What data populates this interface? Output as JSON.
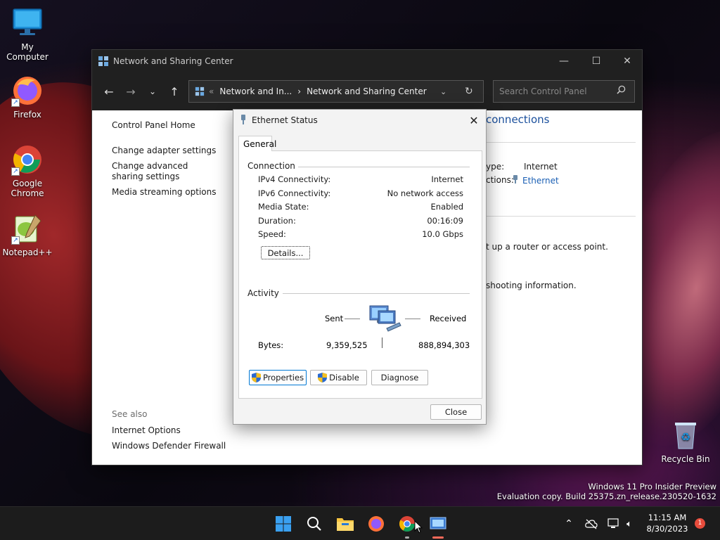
{
  "desktop": {
    "icons": [
      {
        "label": "My Computer"
      },
      {
        "label": "Firefox"
      },
      {
        "label": "Google Chrome"
      },
      {
        "label": "Notepad++"
      },
      {
        "label": "Recycle Bin"
      }
    ],
    "watermark": {
      "line1": "Windows 11 Pro Insider Preview",
      "line2": "Evaluation copy. Build 25375.zn_release.230520-1632"
    }
  },
  "window": {
    "title": "Network and Sharing Center",
    "address": {
      "prefix": "«",
      "crumb1": "Network and In...",
      "sep": "›",
      "crumb2": "Network and Sharing Center"
    },
    "search_placeholder": "Search Control Panel",
    "left_nav": {
      "home": "Control Panel Home",
      "items": [
        "Change adapter settings",
        "Change advanced sharing settings",
        "Media streaming options"
      ]
    },
    "see_also": {
      "header": "See also",
      "items": [
        "Internet Options",
        "Windows Defender Firewall"
      ]
    },
    "main": {
      "heading_fragment": "connections",
      "type_label": "ype:",
      "type_value": "Internet",
      "connections_label": "ctions:",
      "connections_value": "Ethernet",
      "router_text": "t up a router or access point.",
      "troubleshoot_text": "shooting information."
    }
  },
  "dialog": {
    "title": "Ethernet Status",
    "tab": "General",
    "connection": {
      "label": "Connection",
      "rows": [
        {
          "k": "IPv4 Connectivity:",
          "v": "Internet"
        },
        {
          "k": "IPv6 Connectivity:",
          "v": "No network access"
        },
        {
          "k": "Media State:",
          "v": "Enabled"
        },
        {
          "k": "Duration:",
          "v": "00:16:09"
        },
        {
          "k": "Speed:",
          "v": "10.0 Gbps"
        }
      ],
      "details_button": "Details..."
    },
    "activity": {
      "label": "Activity",
      "sent_label": "Sent",
      "received_label": "Received",
      "bytes_label": "Bytes:",
      "sent_bytes": "9,359,525",
      "received_bytes": "888,894,303"
    },
    "buttons": {
      "properties": "Properties",
      "disable": "Disable",
      "diagnose": "Diagnose",
      "close": "Close"
    }
  },
  "taskbar": {
    "time": "11:15 AM",
    "date": "8/30/2023",
    "notification_count": "1"
  },
  "colors": {
    "link": "#1a5fb4",
    "titlebar": "#202020",
    "taskbar": "#1c1c1c",
    "accent": "#0078d4"
  }
}
